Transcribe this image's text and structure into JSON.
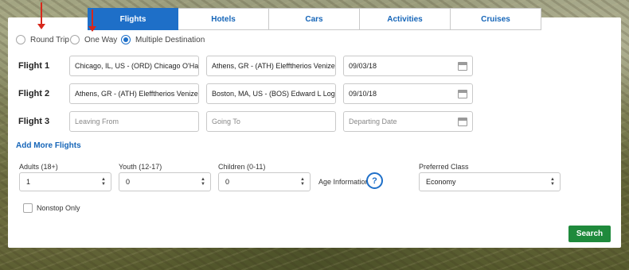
{
  "tabs": [
    {
      "label": "Flights",
      "active": true
    },
    {
      "label": "Hotels",
      "active": false
    },
    {
      "label": "Cars",
      "active": false
    },
    {
      "label": "Activities",
      "active": false
    },
    {
      "label": "Cruises",
      "active": false
    }
  ],
  "trip_types": [
    {
      "label": "Round Trip",
      "checked": false
    },
    {
      "label": "One Way",
      "checked": false
    },
    {
      "label": "Multiple Destination",
      "checked": true
    }
  ],
  "flights": [
    {
      "label": "Flight 1",
      "from": "Chicago, IL, US - (ORD) Chicago O'Hare",
      "to": "Athens, GR - (ATH) Elefftherios Venizelos",
      "date": "09/03/18"
    },
    {
      "label": "Flight 2",
      "from": "Athens, GR - (ATH) Elefftherios Venizelos",
      "to": "Boston, MA, US - (BOS) Edward L Logan",
      "date": "09/10/18"
    },
    {
      "label": "Flight 3",
      "from_placeholder": "Leaving From",
      "to_placeholder": "Going To",
      "date_placeholder": "Departing Date"
    }
  ],
  "add_more_label": "Add More Flights",
  "passengers": {
    "adults": {
      "label": "Adults (18+)",
      "value": "1"
    },
    "youth": {
      "label": "Youth (12-17)",
      "value": "0"
    },
    "children": {
      "label": "Children (0-11)",
      "value": "0"
    },
    "age_info_label": "Age Information",
    "help_glyph": "?"
  },
  "preferred_class": {
    "label": "Preferred Class",
    "value": "Economy"
  },
  "nonstop": {
    "label": "Nonstop Only",
    "checked": false
  },
  "search_label": "Search",
  "icons": {
    "calendar": "calendar-icon",
    "help": "help-icon",
    "annotation_arrow": "red-arrow-icon"
  },
  "colors": {
    "accent": "#1e6fc8",
    "tab_text": "#1565b8",
    "search": "#1f8a3c",
    "annotation": "#d7281c"
  }
}
